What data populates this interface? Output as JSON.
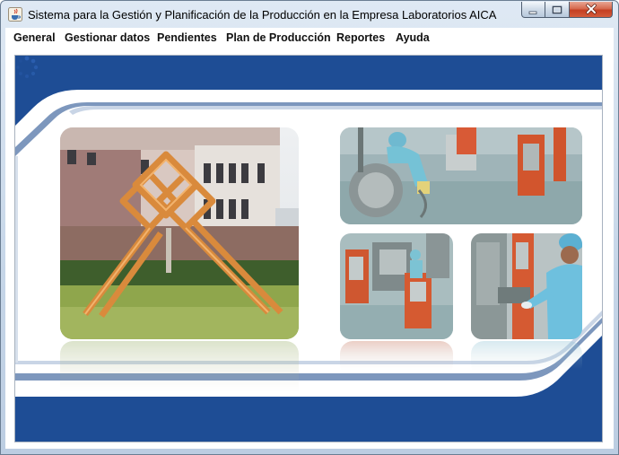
{
  "window": {
    "title": "Sistema para la Gestión y Planificación de la Producción en la Empresa Laboratorios AICA",
    "icon": "java-cup-icon",
    "controls": [
      "minimize-icon",
      "maximize-icon",
      "close-icon"
    ]
  },
  "menu": {
    "items": [
      {
        "label": "General"
      },
      {
        "label": "Gestionar datos"
      },
      {
        "label": "Pendientes"
      },
      {
        "label": "Plan de Producción"
      },
      {
        "label": "Reportes"
      },
      {
        "label": "Ayuda"
      }
    ]
  },
  "splash": {
    "images": [
      "factory-sculpture-photo",
      "laboratory-worker-photo",
      "production-machines-photo",
      "technician-photo"
    ],
    "loading_indicator": "spinner-icon"
  },
  "colors": {
    "frame_blue": "#1f4f97",
    "stripe_light": "#8aa3c7",
    "close_red": "#c9492b"
  }
}
